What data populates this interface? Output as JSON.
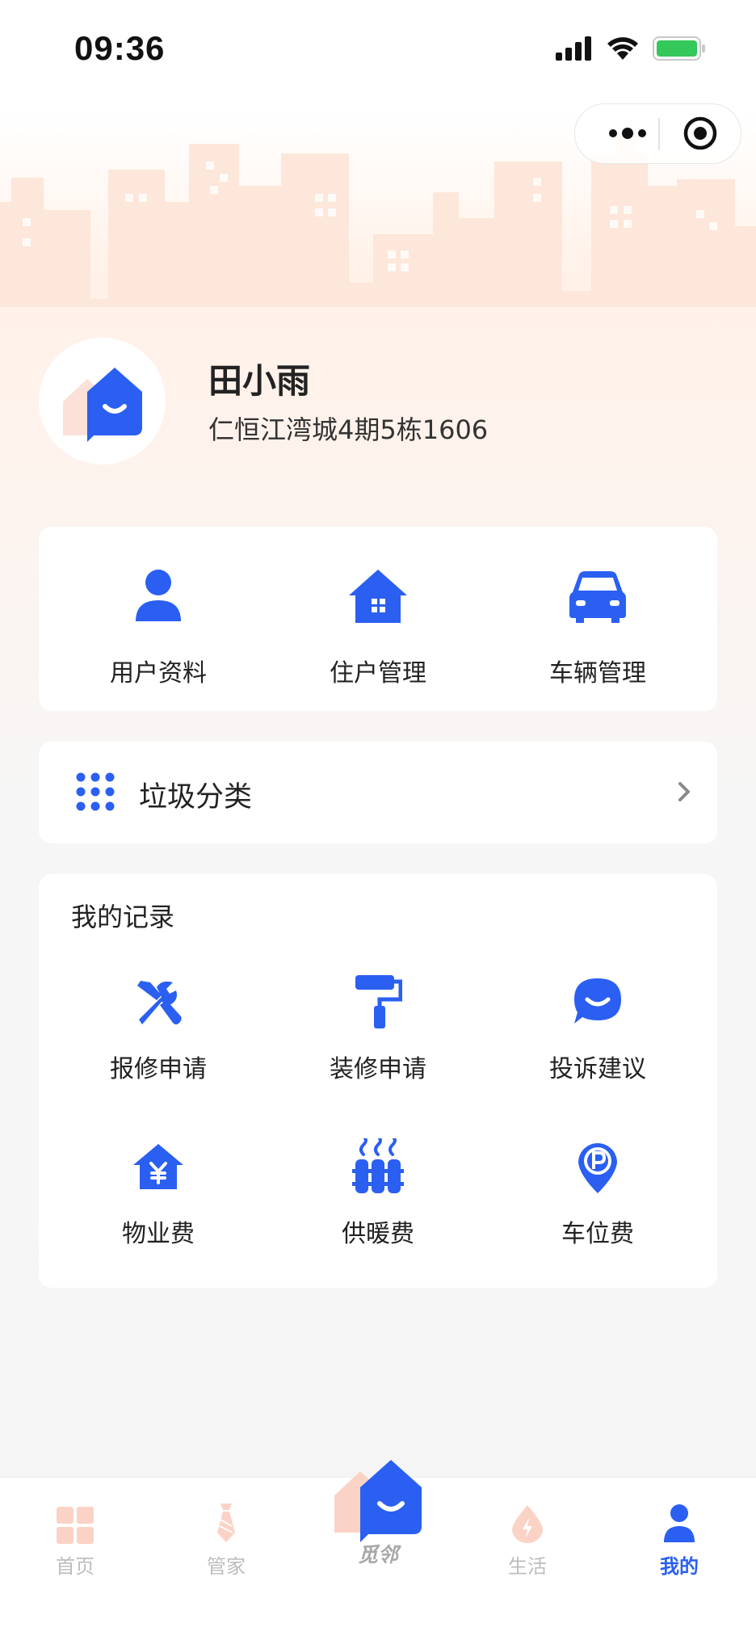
{
  "status_bar": {
    "time": "09:36"
  },
  "profile": {
    "name": "田小雨",
    "address": "仁恒江湾城4期5栋1606"
  },
  "quick_actions": [
    {
      "label": "用户资料",
      "icon": "user-icon"
    },
    {
      "label": "住户管理",
      "icon": "house-icon"
    },
    {
      "label": "车辆管理",
      "icon": "car-icon"
    }
  ],
  "garbage": {
    "label": "垃圾分类",
    "icon": "grid-dots-icon"
  },
  "records": {
    "title": "我的记录",
    "items": [
      {
        "label": "报修申请",
        "icon": "tools-icon"
      },
      {
        "label": "装修申请",
        "icon": "paint-roller-icon"
      },
      {
        "label": "投诉建议",
        "icon": "chat-bubble-icon"
      },
      {
        "label": "物业费",
        "icon": "house-yen-icon"
      },
      {
        "label": "供暖费",
        "icon": "radiator-icon"
      },
      {
        "label": "车位费",
        "icon": "parking-pin-icon"
      }
    ]
  },
  "tabbar": {
    "items": [
      {
        "label": "首页",
        "icon": "home-grid-icon"
      },
      {
        "label": "管家",
        "icon": "tie-icon"
      },
      {
        "label": "觅邻",
        "icon": "brand-logo-icon"
      },
      {
        "label": "生活",
        "icon": "drop-bolt-icon"
      },
      {
        "label": "我的",
        "icon": "user-icon"
      }
    ],
    "active_index": 4
  },
  "colors": {
    "accent": "#2a5ff2",
    "inactive_tab": "#bdbdbd",
    "skyline": "#fde2d3"
  }
}
